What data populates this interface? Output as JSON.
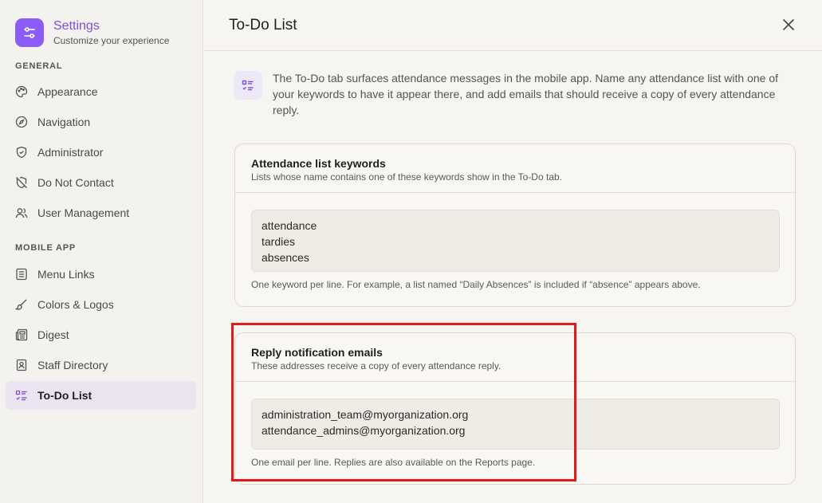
{
  "app": {
    "title": "Settings",
    "subtitle": "Customize your experience"
  },
  "sidebar": {
    "sections": [
      {
        "label": "GENERAL",
        "items": [
          {
            "label": "Appearance",
            "icon": "palette-icon"
          },
          {
            "label": "Navigation",
            "icon": "compass-icon"
          },
          {
            "label": "Administrator",
            "icon": "shield-icon"
          },
          {
            "label": "Do Not Contact",
            "icon": "shield-off-icon"
          },
          {
            "label": "User Management",
            "icon": "users-icon"
          }
        ]
      },
      {
        "label": "MOBILE APP",
        "items": [
          {
            "label": "Menu Links",
            "icon": "list-icon"
          },
          {
            "label": "Colors & Logos",
            "icon": "brush-icon"
          },
          {
            "label": "Digest",
            "icon": "newspaper-icon"
          },
          {
            "label": "Staff Directory",
            "icon": "contact-book-icon"
          },
          {
            "label": "To-Do List",
            "icon": "checklist-icon",
            "active": true
          }
        ]
      }
    ]
  },
  "header": {
    "title": "To-Do List",
    "close_icon": "close-icon"
  },
  "intro": {
    "icon": "checklist-icon",
    "text": "The To-Do tab surfaces attendance messages in the mobile app. Name any attendance list with one of your keywords to have it appear there, and add emails that should receive a copy of every attendance reply."
  },
  "keywords_card": {
    "title": "Attendance list keywords",
    "subtitle": "Lists whose name contains one of these keywords show in the To-Do tab.",
    "value": "attendance\ntardies\nabsences",
    "help": "One keyword per line. For example, a list named “Daily Absences” is included if “absence” appears above."
  },
  "emails_card": {
    "title": "Reply notification emails",
    "subtitle": "These addresses receive a copy of every attendance reply.",
    "value": "administration_team@myorganization.org\nattendance_admins@myorganization.org",
    "help": "One email per line. Replies are also available on the Reports page."
  },
  "colors": {
    "accent": "#8b5cf6",
    "highlight": "#e01b1b"
  }
}
